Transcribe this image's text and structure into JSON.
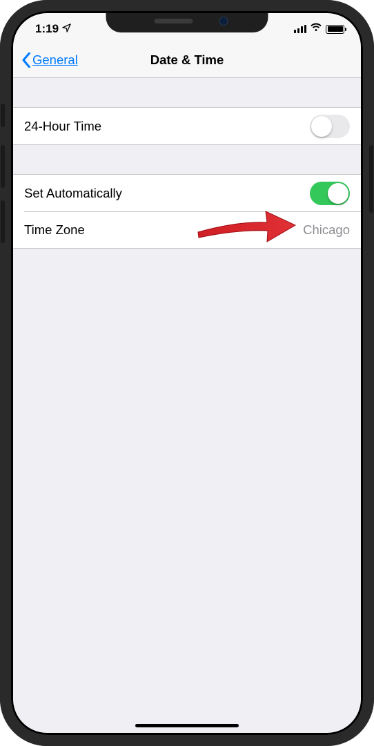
{
  "statusBar": {
    "time": "1:19"
  },
  "nav": {
    "backLabel": "General",
    "title": "Date & Time"
  },
  "rows": {
    "twentyFourHourLabel": "24-Hour Time",
    "setAutoLabel": "Set Automatically",
    "timeZoneLabel": "Time Zone",
    "timeZoneValue": "Chicago"
  },
  "toggles": {
    "twentyFourHour": false,
    "setAutomatically": true
  },
  "colors": {
    "accent": "#007aff",
    "toggleOn": "#34c759",
    "annotationArrow": "#d92027"
  }
}
